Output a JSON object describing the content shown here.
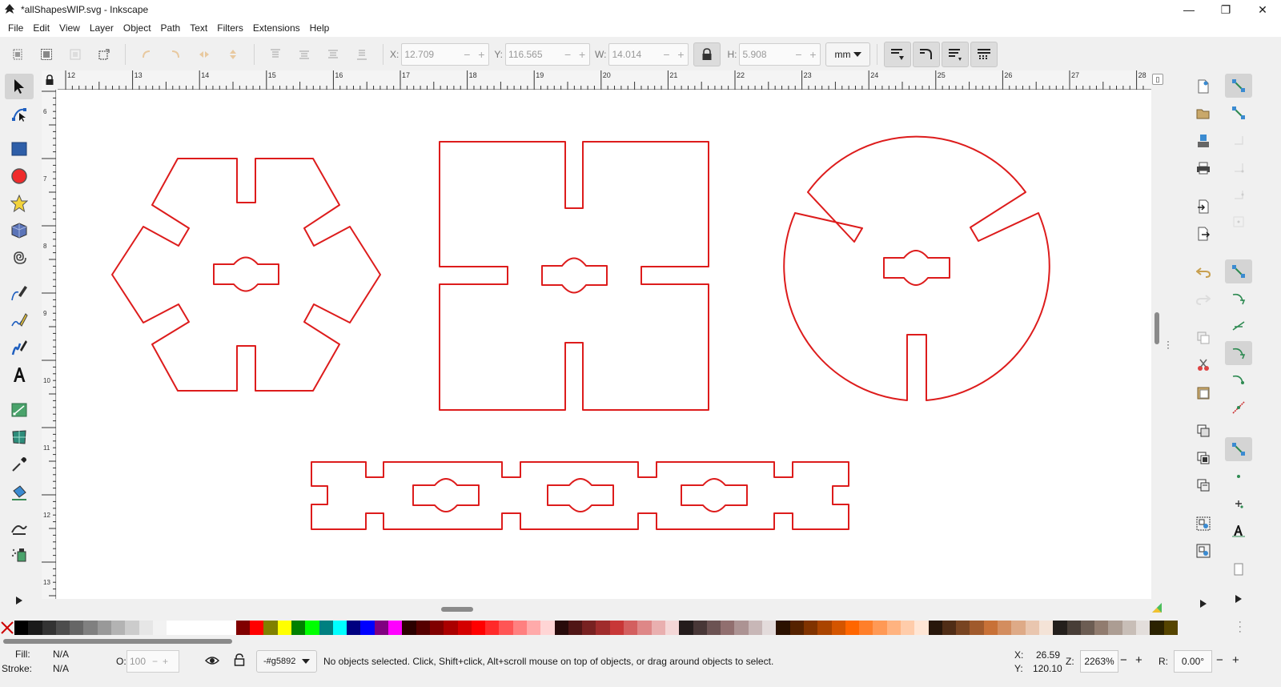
{
  "window": {
    "title": "*allShapesWIP.svg - Inkscape",
    "minimize": "—",
    "maximize": "❐",
    "close": "✕"
  },
  "menu": [
    "File",
    "Edit",
    "View",
    "Layer",
    "Object",
    "Path",
    "Text",
    "Filters",
    "Extensions",
    "Help"
  ],
  "toolbar": {
    "x_label": "X:",
    "x_value": "12.709",
    "y_label": "Y:",
    "y_value": "116.565",
    "w_label": "W:",
    "w_value": "14.014",
    "h_label": "H:",
    "h_value": "5.908",
    "unit": "mm",
    "minus": "−",
    "plus": "+"
  },
  "ruler_labels": [
    "12",
    "13",
    "14",
    "15",
    "16",
    "17",
    "18",
    "19",
    "20",
    "21",
    "22",
    "23",
    "24",
    "25",
    "26",
    "27",
    "28"
  ],
  "ruler_left_labels": [
    "6",
    "7",
    "8",
    "9",
    "10",
    "11",
    "12",
    "13"
  ],
  "canvas": {
    "stroke_color": "#dd1c1c",
    "shapes": [
      "hexagon-part",
      "square-part",
      "circle-part",
      "strip-part"
    ]
  },
  "palette": {
    "colors": [
      "#000000",
      "#1a1a1a",
      "#333333",
      "#4d4d4d",
      "#666666",
      "#808080",
      "#999999",
      "#b3b3b3",
      "#cccccc",
      "#e6e6e6",
      "#f2f2f2",
      "#ffffff",
      "#ffffff",
      "#ffffff",
      "#ffffff",
      "#ffffff",
      "#800000",
      "#ff0000",
      "#808000",
      "#ffff00",
      "#008000",
      "#00ff00",
      "#008080",
      "#00ffff",
      "#000080",
      "#0000ff",
      "#800080",
      "#ff00ff",
      "#2b0000",
      "#550000",
      "#800000",
      "#aa0000",
      "#d40000",
      "#ff0000",
      "#ff2a2a",
      "#ff5555",
      "#ff8080",
      "#ffaaaa",
      "#ffd5d5",
      "#280b0b",
      "#501616",
      "#782121",
      "#a02c2c",
      "#c83737",
      "#d35f5f",
      "#de8787",
      "#e9afaf",
      "#f4d7d7",
      "#241c1c",
      "#483737",
      "#6c5353",
      "#916f6f",
      "#ac9393",
      "#c8b7b7",
      "#e3dbdb",
      "#2b1100",
      "#552200",
      "#803300",
      "#aa4400",
      "#d45500",
      "#ff6600",
      "#ff7f2a",
      "#ff9955",
      "#ffb380",
      "#ffccaa",
      "#ffe6d5",
      "#28170b",
      "#502d16",
      "#784421",
      "#a05a2c",
      "#c87137",
      "#d38d5f",
      "#deaa87",
      "#e9c6af",
      "#f4e3d7",
      "#241f1c",
      "#483e37",
      "#6c5d53",
      "#917c6f",
      "#ac9d93",
      "#c8beb7",
      "#e3dedb",
      "#2b2200",
      "#554400"
    ]
  },
  "status": {
    "fill_label": "Fill:",
    "fill_value": "N/A",
    "stroke_label": "Stroke:",
    "stroke_value": "N/A",
    "opacity_label": "O:",
    "opacity_value": "100",
    "layer": "-#g5892",
    "message": "No objects selected. Click, Shift+click, Alt+scroll mouse on top of objects, or drag around objects to select.",
    "cursor_x_label": "X:",
    "cursor_x": "26.59",
    "cursor_y_label": "Y:",
    "cursor_y": "120.10",
    "zoom_label": "Z:",
    "zoom": "2263%",
    "rotate_label": "R:",
    "rotate": "0.00°"
  }
}
